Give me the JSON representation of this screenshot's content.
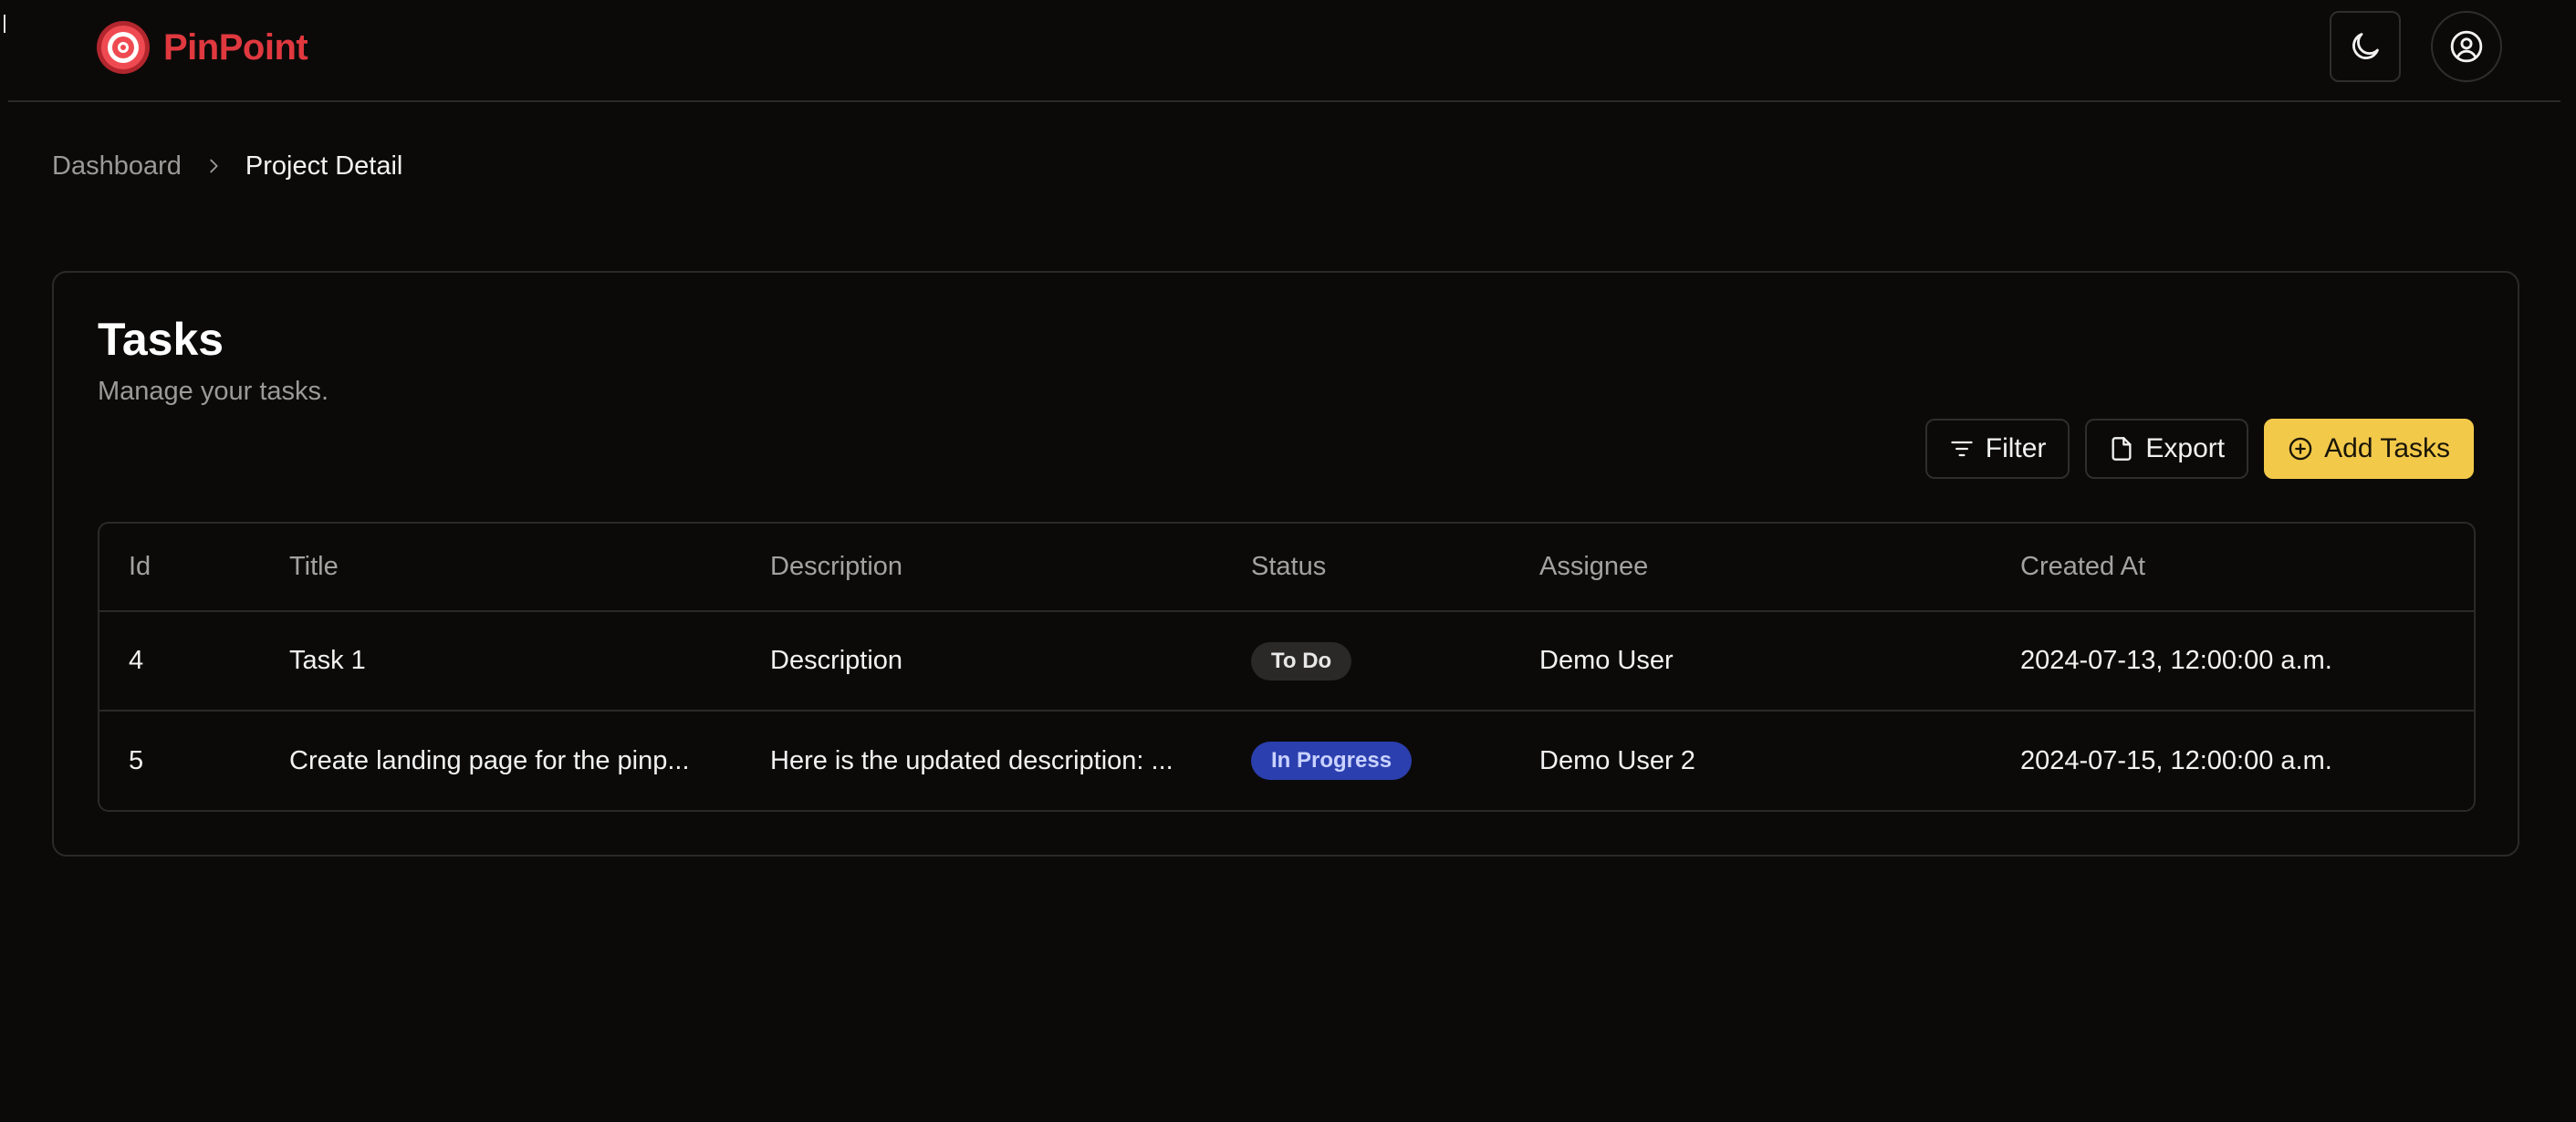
{
  "header": {
    "brand_name": "PinPoint",
    "brand_color": "#e0383f",
    "brand_icon": "target-logo-icon",
    "theme_toggle_icon": "moon-icon",
    "account_icon": "user-circle-icon"
  },
  "breadcrumb": {
    "items": [
      "Dashboard",
      "Project Detail"
    ],
    "separator_icon": "chevron-right-icon"
  },
  "tasks_card": {
    "title": "Tasks",
    "subtitle": "Manage your tasks.",
    "actions": {
      "filter_label": "Filter",
      "filter_icon": "filter-icon",
      "export_label": "Export",
      "export_icon": "file-icon",
      "add_label": "Add Tasks",
      "add_icon": "plus-circle-icon",
      "add_color": "#f3c94a"
    },
    "table": {
      "columns": [
        "Id",
        "Title",
        "Description",
        "Status",
        "Assignee",
        "Created At"
      ],
      "rows": [
        {
          "id": "4",
          "title": "Task 1",
          "description": "Description",
          "status": "To Do",
          "status_bg": "#2a2928",
          "status_fg": "#e8e8e8",
          "assignee": "Demo User",
          "created_at": "2024-07-13, 12:00:00 a.m."
        },
        {
          "id": "5",
          "title": "Create landing page for the pinp...",
          "description": "Here is the updated description: ...",
          "status": "In Progress",
          "status_bg": "#2b3fae",
          "status_fg": "#c9d2ff",
          "assignee": "Demo User 2",
          "created_at": "2024-07-15, 12:00:00 a.m."
        }
      ]
    }
  }
}
